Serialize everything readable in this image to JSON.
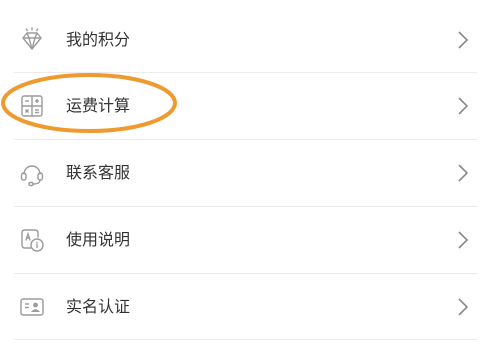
{
  "menu": {
    "items": [
      {
        "label": "我的积分",
        "icon": "diamond-icon"
      },
      {
        "label": "运费计算",
        "icon": "calculator-icon"
      },
      {
        "label": "联系客服",
        "icon": "headset-icon"
      },
      {
        "label": "使用说明",
        "icon": "manual-icon"
      },
      {
        "label": "实名认证",
        "icon": "id-card-icon"
      }
    ],
    "chevron_icon": "chevron-right-icon"
  },
  "annotation": {
    "color": "#ee9a2e",
    "target": "运费计算"
  },
  "colors": {
    "icon": "#9b9b9b",
    "chevron": "#8a8a8a",
    "text": "#333333",
    "divider": "#ececec"
  }
}
